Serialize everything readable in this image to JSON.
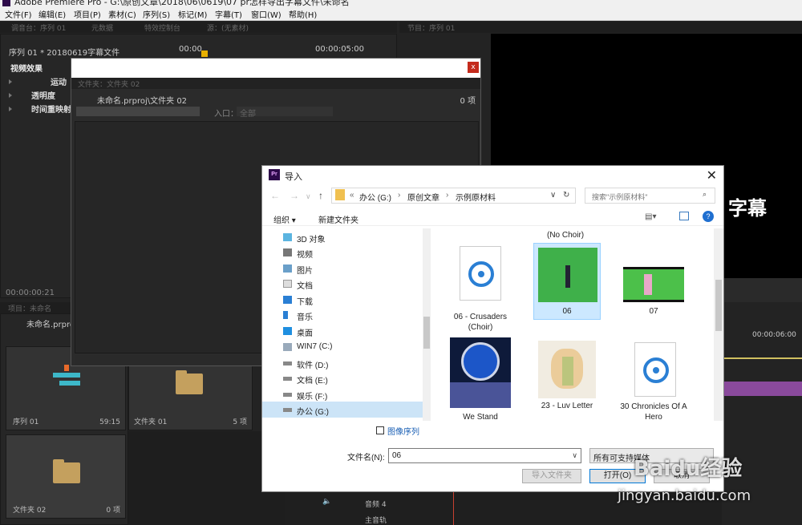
{
  "titlebar": {
    "title": "Adobe Premiere Pro - G:\\原创文章\\2018\\06\\0619\\07 pr怎样导出字幕文件\\未命名"
  },
  "menu": [
    "文件(F)",
    "编辑(E)",
    "项目(P)",
    "素材(C)",
    "序列(S)",
    "标记(M)",
    "字幕(T)",
    "窗口(W)",
    "帮助(H)"
  ],
  "top_tabs": [
    "调音台：序列 01",
    "元数据",
    "特效控制台",
    "源：(无素材)"
  ],
  "program_tab": "节目：序列 01",
  "effects": {
    "sequence_label": "序列 01 * 20180619字幕文件",
    "tc_start": "00:00",
    "tc_end": "00:00:05:00",
    "video_fx": "视频效果",
    "rows": [
      "运动",
      "透明度",
      "时间重映射"
    ],
    "timecode": "00:00:00:21"
  },
  "project": {
    "tab": "项目：未命名",
    "file": "未命名.prproj",
    "items": [
      {
        "label": "序列 01",
        "count": "59:15"
      },
      {
        "label": "文件夹 01",
        "count": "5 项"
      },
      {
        "label": "文件夹 02",
        "count": "0 项"
      }
    ]
  },
  "folder_panel": {
    "tab": "文件夹：文件夹 02",
    "path": "未命名.prproj\\文件夹 02",
    "count": "0 项",
    "entry_label": "入口：",
    "entry_value": "全部"
  },
  "program": {
    "overlay": "字幕",
    "timecode": "00:00:06:00"
  },
  "timeline": {
    "audio4": "音频 4",
    "master": "主音轨"
  },
  "dialog": {
    "icon": "Pr",
    "title": "导入",
    "breadcrumb": [
      "办公 (G:)",
      "原创文章",
      "示例原材料"
    ],
    "search_placeholder": "搜索\"示例原材料\"",
    "organize": "组织 ▾",
    "new_folder": "新建文件夹",
    "tree": [
      "3D 对象",
      "视频",
      "图片",
      "文档",
      "下载",
      "音乐",
      "桌面",
      "WIN7 (C:)",
      "软件 (D:)",
      "文档 (E:)",
      "娱乐 (F:)",
      "办公 (G:)"
    ],
    "no_choir": "(No Choir)",
    "files": [
      "06 - Crusaders (Choir)",
      "06",
      "07",
      "We Stand",
      "23 - Luv Letter",
      "30 Chronicles Of A Hero"
    ],
    "image_sequence": "图像序列",
    "filename_label": "文件名(N):",
    "filename_value": "06",
    "filter": "所有可支持媒体",
    "import_folder": "导入文件夹",
    "open": "打开(O)",
    "cancel": "取消"
  },
  "watermark": {
    "brand": "Baidu经验",
    "url": "jingyan.baidu.com"
  }
}
